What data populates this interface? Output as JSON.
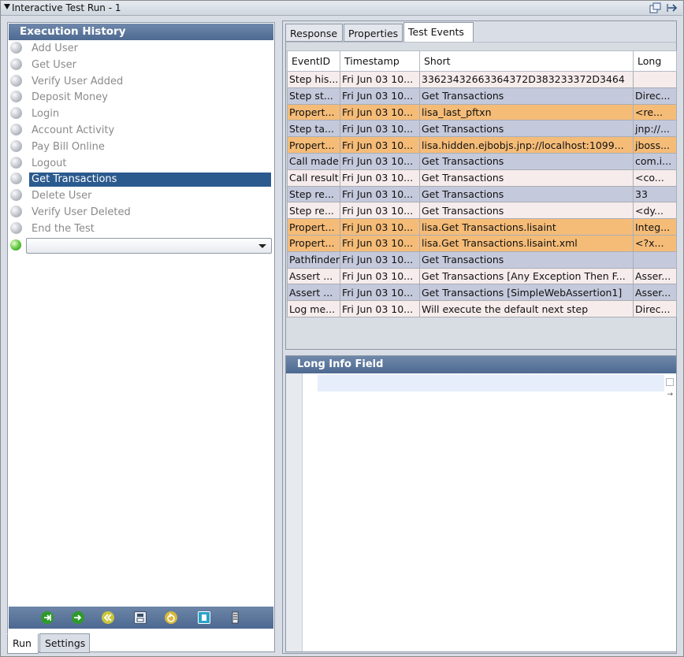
{
  "window": {
    "title": "Interactive Test Run - 1"
  },
  "history": {
    "header": "Execution History",
    "items": [
      {
        "label": "Add User"
      },
      {
        "label": "Get User"
      },
      {
        "label": "Verify User Added"
      },
      {
        "label": "Deposit Money"
      },
      {
        "label": "Login"
      },
      {
        "label": "Account Activity"
      },
      {
        "label": "Pay Bill Online"
      },
      {
        "label": "Logout"
      },
      {
        "label": "Get Transactions",
        "selected": true
      },
      {
        "label": "Delete User"
      },
      {
        "label": "Verify User Deleted"
      },
      {
        "label": "End the Test"
      }
    ],
    "next_step_value": ""
  },
  "left_tabs": [
    "Run",
    "Settings"
  ],
  "right_tabs": [
    "Response",
    "Properties",
    "Test Events"
  ],
  "events": {
    "columns": [
      "EventID",
      "Timestamp",
      "Short",
      "Long"
    ],
    "rows": [
      {
        "id": "Step his...",
        "ts": "Fri Jun 03 10...",
        "short": "33623432663364372D383233372D3464",
        "long": "",
        "color": "pink"
      },
      {
        "id": "Step st...",
        "ts": "Fri Jun 03 10...",
        "short": "Get Transactions",
        "long": "Direc...",
        "color": "blue"
      },
      {
        "id": "Propert...",
        "ts": "Fri Jun 03 10...",
        "short": "lisa_last_pftxn",
        "long": " <re...",
        "color": "orange"
      },
      {
        "id": "Step ta...",
        "ts": "Fri Jun 03 10...",
        "short": "Get Transactions",
        "long": "jnp://...",
        "color": "blue"
      },
      {
        "id": "Propert...",
        "ts": "Fri Jun 03 10...",
        "short": "lisa.hidden.ejbobjs.jnp://localhost:1099...",
        "long": "jboss...",
        "color": "orange"
      },
      {
        "id": "Call made",
        "ts": "Fri Jun 03 10...",
        "short": "Get Transactions",
        "long": "com.i...",
        "color": "blue"
      },
      {
        "id": "Call result",
        "ts": "Fri Jun 03 10...",
        "short": "Get Transactions",
        "long": " <co...",
        "color": "pink"
      },
      {
        "id": "Step re...",
        "ts": "Fri Jun 03 10...",
        "short": "Get Transactions",
        "long": "33",
        "color": "blue"
      },
      {
        "id": "Step re...",
        "ts": "Fri Jun 03 10...",
        "short": "Get Transactions",
        "long": " <dy...",
        "color": "pink"
      },
      {
        "id": "Propert...",
        "ts": "Fri Jun 03 10...",
        "short": "lisa.Get Transactions.lisaint",
        "long": "Integ...",
        "color": "orange"
      },
      {
        "id": "Propert...",
        "ts": "Fri Jun 03 10...",
        "short": "lisa.Get Transactions.lisaint.xml",
        "long": " <?x...",
        "color": "orange"
      },
      {
        "id": "Pathfinder",
        "ts": "Fri Jun 03 10...",
        "short": "Get Transactions",
        "long": "",
        "color": "blue"
      },
      {
        "id": "Assert ...",
        "ts": "Fri Jun 03 10...",
        "short": "Get Transactions [Any Exception Then F...",
        "long": "Asser...",
        "color": "pink"
      },
      {
        "id": "Assert ...",
        "ts": "Fri Jun 03 10...",
        "short": "Get Transactions [SimpleWebAssertion1]",
        "long": "Asser...",
        "color": "blue"
      },
      {
        "id": "Log me...",
        "ts": "Fri Jun 03 10...",
        "short": "Will execute the default next step",
        "long": "Direc...",
        "color": "pink"
      }
    ]
  },
  "long_info": {
    "header": "Long Info Field",
    "content": ""
  },
  "colors": {
    "header_blue": "#5a7399",
    "selection": "#2a5a8e",
    "row_pink": "#f6eceb",
    "row_blue": "#c5c9dc",
    "row_orange": "#f5bc78"
  },
  "toolbar_icons": [
    "step-into-icon",
    "step-over-icon",
    "rewind-icon",
    "save-icon",
    "refresh-icon",
    "delete-icon",
    "checklist-icon"
  ]
}
